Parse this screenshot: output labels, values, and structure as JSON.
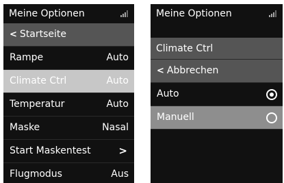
{
  "left_screen": {
    "title": "Meine Optionen",
    "back_label": "Startseite",
    "items": [
      {
        "label": "Rampe",
        "value": "Auto"
      },
      {
        "label": "Climate Ctrl",
        "value": "Auto"
      },
      {
        "label": "Temperatur",
        "value": "Auto"
      },
      {
        "label": "Maske",
        "value": "Nasal"
      },
      {
        "label": "Start Maskentest",
        "value": ""
      },
      {
        "label": "Flugmodus",
        "value": "Aus"
      }
    ],
    "selected_item": "Climate Ctrl"
  },
  "right_screen": {
    "title": "Meine Optionen",
    "submenu_title": "Climate Ctrl",
    "cancel_label": "Abbrechen",
    "options": [
      {
        "label": "Auto",
        "selected": true
      },
      {
        "label": "Manuell",
        "selected": false
      }
    ],
    "highlighted_option": "Manuell"
  },
  "icons": {
    "signal": "signal-strength-icon",
    "back": "chevron-left-icon",
    "forward": "chevron-right-icon",
    "radio_on": "radio-selected-icon",
    "radio_off": "radio-unselected-icon"
  },
  "colors": {
    "background": "#111111",
    "menu_row": "#555555",
    "selected_row": "#c7c7c7",
    "highlighted_option": "#8e8e8e",
    "text": "#ffffff"
  }
}
